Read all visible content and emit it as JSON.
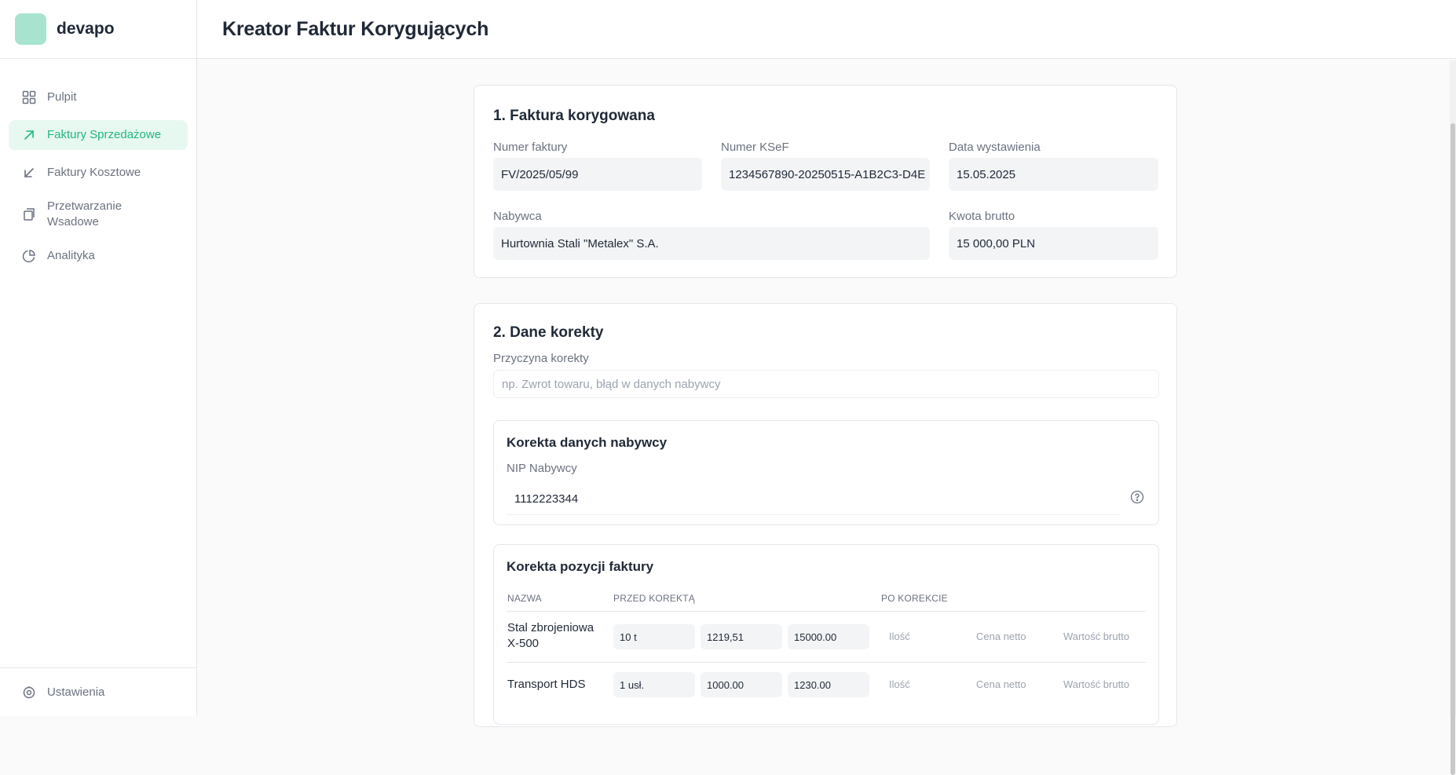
{
  "brand": {
    "name": "devapo"
  },
  "sidebar": {
    "items": [
      {
        "label": "Pulpit",
        "icon": "grid-icon"
      },
      {
        "label": "Faktury Sprzedażowe",
        "icon": "arrow-up-right-icon"
      },
      {
        "label": "Faktury Kosztowe",
        "icon": "arrow-down-left-icon"
      },
      {
        "label": "Przetwarzanie Wsadowe",
        "icon": "batch-files-icon"
      },
      {
        "label": "Analityka",
        "icon": "pie-chart-icon"
      }
    ],
    "footer": {
      "label": "Ustawienia",
      "icon": "settings-icon"
    }
  },
  "header": {
    "title": "Kreator Faktur Korygujących"
  },
  "section1": {
    "title": "1. Faktura korygowana",
    "invoice_number_label": "Numer faktury",
    "invoice_number": "FV/2025/05/99",
    "ksef_label": "Numer KSeF",
    "ksef": "1234567890-20250515-A1B2C3-D4E",
    "issue_date_label": "Data wystawienia",
    "issue_date": "15.05.2025",
    "buyer_label": "Nabywca",
    "buyer": "Hurtownia Stali \"Metalex\" S.A.",
    "gross_label": "Kwota brutto",
    "gross": "15 000,00 PLN"
  },
  "section2": {
    "title": "2. Dane korekty",
    "reason_label": "Przyczyna korekty",
    "reason_placeholder": "np. Zwrot towaru, błąd w danych nabywcy",
    "buyer_correction": {
      "title": "Korekta danych nabywcy",
      "nip_label": "NIP Nabywcy",
      "nip": "1112223344"
    },
    "items_correction": {
      "title": "Korekta pozycji faktury",
      "columns": {
        "name": "NAZWA",
        "before": "PRZED KOREKTĄ",
        "after": "PO KOREKCIE"
      },
      "placeholders": {
        "qty": "Ilość",
        "net": "Cena netto",
        "gross": "Wartość brutto"
      },
      "rows": [
        {
          "name": "Stal zbrojeniowa X-500",
          "qty": "10 t",
          "net": "1219,51",
          "gross": "15000.00"
        },
        {
          "name": "Transport HDS",
          "qty": "1 usł.",
          "net": "1000.00",
          "gross": "1230.00"
        }
      ]
    }
  }
}
